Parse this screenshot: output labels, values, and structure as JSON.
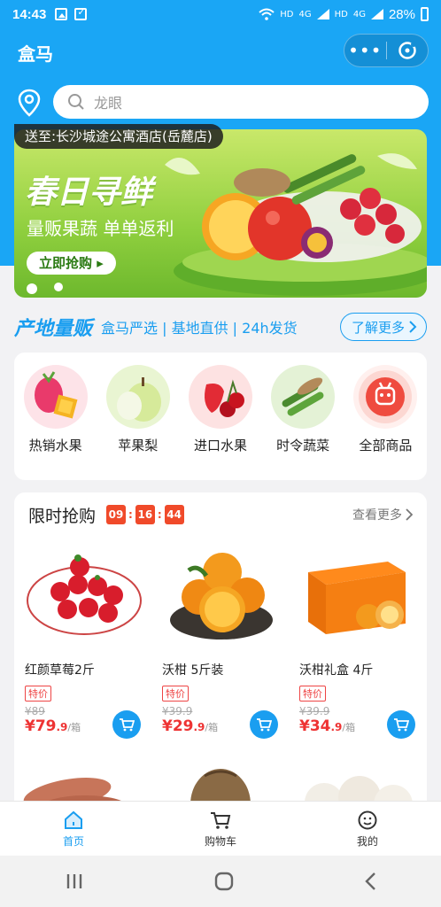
{
  "status_bar": {
    "time": "14:43",
    "battery": "28%",
    "network_labels": [
      "HD",
      "4G",
      "HD",
      "4G"
    ]
  },
  "header": {
    "title": "盒马",
    "more_label": "•••"
  },
  "search": {
    "placeholder": "龙眼"
  },
  "delivery": {
    "text": "送至:长沙城途公寓酒店(岳麓店)"
  },
  "banner": {
    "headline": "春日寻鲜",
    "subline": "量贩果蔬 单单返利",
    "cta": "立即抢购 ▸"
  },
  "source": {
    "brand": "产地量贩",
    "tags": "盒马严选 | 基地直供 | 24h发货",
    "learn_more": "了解更多"
  },
  "categories": [
    {
      "label": "热销水果",
      "icon": "tropical-fruit-icon"
    },
    {
      "label": "苹果梨",
      "icon": "pear-icon"
    },
    {
      "label": "进口水果",
      "icon": "strawberry-cherry-icon"
    },
    {
      "label": "时令蔬菜",
      "icon": "vegetables-icon"
    },
    {
      "label": "全部商品",
      "icon": "all-goods-icon"
    }
  ],
  "flash_sale": {
    "title": "限时抢购",
    "timer": [
      "09",
      "16",
      "44"
    ],
    "more": "查看更多",
    "products": [
      {
        "name": "红颜草莓2斤",
        "badge": "特价",
        "original": "¥89",
        "price_int": "¥79",
        "price_dec": ".9",
        "unit": "/箱"
      },
      {
        "name": "沃柑 5斤装",
        "badge": "特价",
        "original": "¥39.9",
        "price_int": "¥29",
        "price_dec": ".9",
        "unit": "/箱"
      },
      {
        "name": "沃柑礼盒 4斤",
        "badge": "特价",
        "original": "¥39.9",
        "price_int": "¥34",
        "price_dec": ".9",
        "unit": "/箱"
      }
    ]
  },
  "tabbar": [
    {
      "label": "首页",
      "active": true
    },
    {
      "label": "购物车",
      "active": false
    },
    {
      "label": "我的",
      "active": false
    }
  ],
  "colors": {
    "brand_blue": "#1aa6f5",
    "price_red": "#e33",
    "timer_red": "#f04a2a"
  }
}
